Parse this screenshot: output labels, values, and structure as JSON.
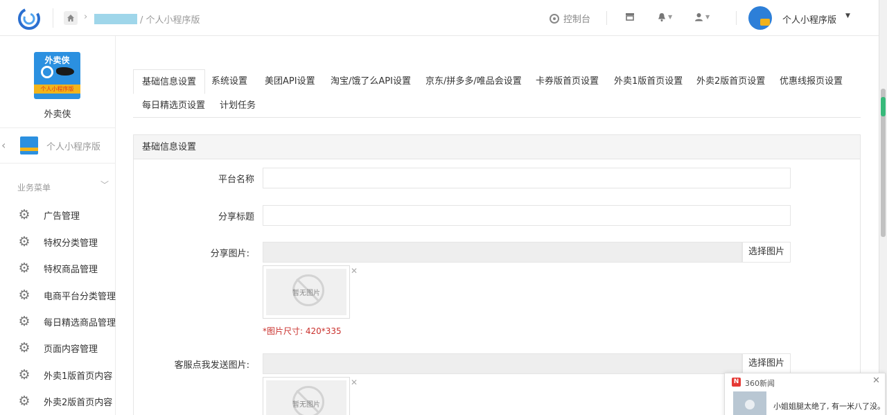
{
  "breadcrumb": {
    "current": "/ 个人小程序版"
  },
  "header": {
    "console_label": "控制台",
    "user_name": "个人小程序版"
  },
  "sidebar": {
    "app_name": "外卖侠",
    "logo_text": "外卖侠",
    "logo_band": "个人小程序版",
    "current_app": "个人小程序版",
    "menu_title": "业务菜单",
    "items": [
      {
        "label": "广告管理"
      },
      {
        "label": "特权分类管理"
      },
      {
        "label": "特权商品管理"
      },
      {
        "label": "电商平台分类管理"
      },
      {
        "label": "每日精选商品管理"
      },
      {
        "label": "页面内容管理"
      },
      {
        "label": "外卖1版首页内容"
      },
      {
        "label": "外卖2版首页内容"
      }
    ]
  },
  "tabs": [
    {
      "label": "基础信息设置",
      "active": true
    },
    {
      "label": "系统设置"
    },
    {
      "label": "美团API设置"
    },
    {
      "label": "淘宝/饿了么API设置"
    },
    {
      "label": "京东/拼多多/唯品会设置"
    },
    {
      "label": "卡券版首页设置"
    },
    {
      "label": "外卖1版首页设置"
    },
    {
      "label": "外卖2版首页设置"
    },
    {
      "label": "优惠线报页设置"
    },
    {
      "label": "每日精选页设置"
    },
    {
      "label": "计划任务"
    }
  ],
  "panel": {
    "title": "基础信息设置"
  },
  "form": {
    "platform_name": {
      "label": "平台名称",
      "value": ""
    },
    "share_title": {
      "label": "分享标题",
      "value": ""
    },
    "share_image": {
      "label": "分享图片:",
      "button": "选择图片",
      "placeholder": "暂无图片",
      "tip": "*图片尺寸: 420*335"
    },
    "service_image": {
      "label": "客服点我发送图片:",
      "button": "选择图片",
      "placeholder": "暂无图片"
    }
  },
  "news_popup": {
    "source": "360新闻",
    "headline": "小姐姐腿太绝了, 有一米八了没。"
  },
  "colors": {
    "accent": "#2b90e0",
    "tip_red": "#c9302c",
    "logo_yellow": "#f2b41b"
  }
}
